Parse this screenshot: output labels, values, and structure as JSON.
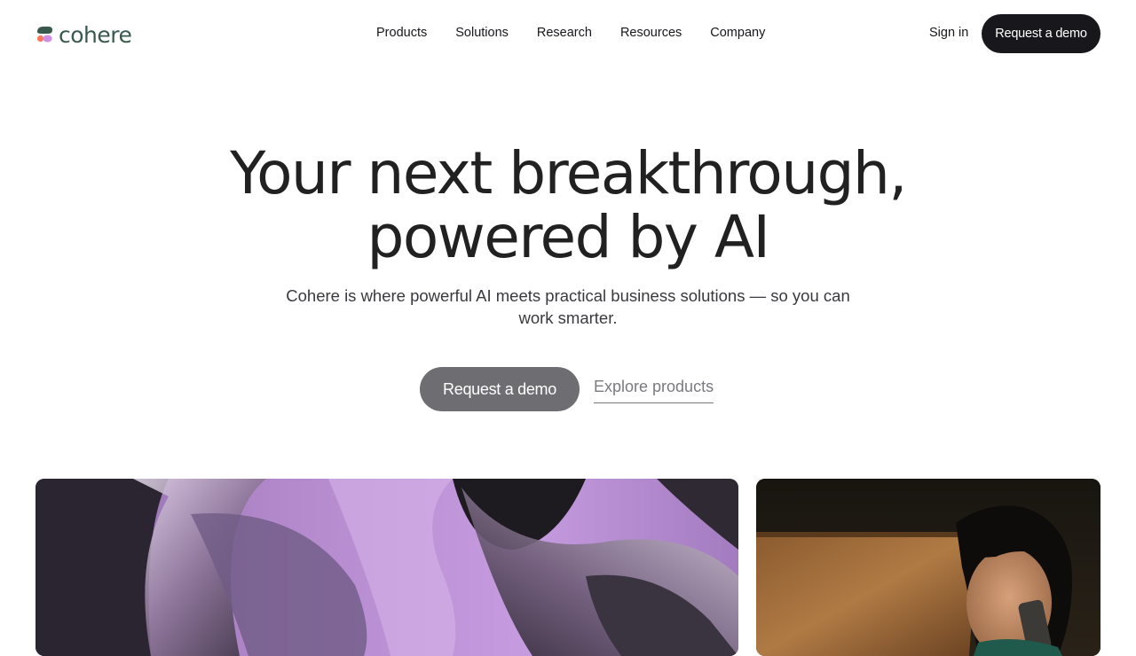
{
  "brand": {
    "name": "cohere",
    "colors": {
      "logo_text": "#39594d",
      "mark_green": "#39594d",
      "mark_coral": "#ff7759",
      "mark_lilac": "#d18ee2",
      "dark": "#17171c",
      "cta_hero": "#6e6d72"
    }
  },
  "nav": {
    "links": [
      "Products",
      "Solutions",
      "Research",
      "Resources",
      "Company"
    ],
    "signin": "Sign in",
    "cta": "Request a demo"
  },
  "hero": {
    "title_lines": [
      "Your next breakthrough,",
      "powered by AI"
    ],
    "subtitle_lines": [
      "Cohere is where powerful AI meets practical business solutions — so you can",
      "work smarter."
    ],
    "primary_cta": "Request a demo",
    "secondary_cta": "Explore products"
  },
  "media": {
    "left_image": "abstract-purple-glass-shapes",
    "right_image": "woman-on-phone-at-wooden-desk"
  }
}
